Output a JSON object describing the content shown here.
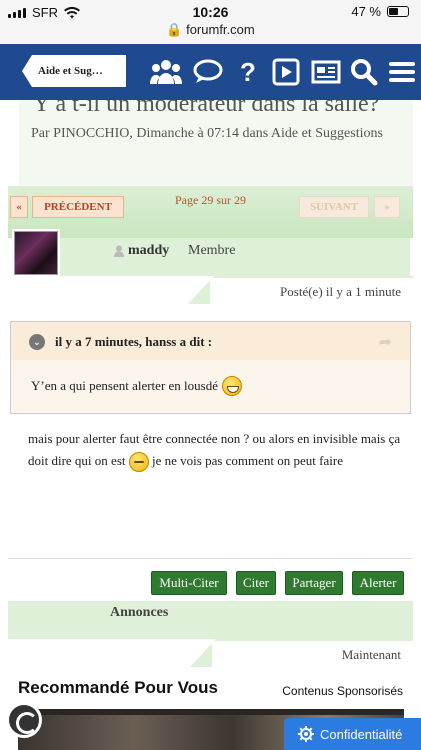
{
  "status_bar": {
    "carrier": "SFR",
    "time": "10:26",
    "battery": "47 %",
    "url": "forumfr.com"
  },
  "header": {
    "back_label": "Aide et Sug…",
    "icons": [
      "users-icon",
      "chat-icon",
      "help-icon",
      "video-icon",
      "news-icon",
      "search-icon",
      "menu-icon"
    ]
  },
  "topic": {
    "title": "Y a t-il un modérateur dans la salle?",
    "byline_prefix": "Par",
    "author": "PINOCCHIO,",
    "date_text": "Dimanche à 07:14 dans Aide et Suggestions"
  },
  "pagination": {
    "first": "«",
    "prev": "PRÉCÉDENT",
    "info": "Page 29 sur 29",
    "next": "SUIVANT",
    "last": "»"
  },
  "post": {
    "username": "maddy",
    "role": "Membre",
    "posted": "Posté(e) il y a 1 minute",
    "quote_header": "il y a 7 minutes, hanss a dit :",
    "quote_text": "Y’en a qui pensent alerter en lousdé",
    "body_part1": "mais pour alerter faut être connectée non ? ou alors en invisible mais ça doit dire qui on est",
    "body_part2": "je ne vois pas comment on peut faire"
  },
  "actions": {
    "multi_quote": "Multi-Citer",
    "quote": "Citer",
    "share": "Partager",
    "report": "Alerter"
  },
  "announcements": {
    "title": "Annonces",
    "time": "Maintenant"
  },
  "recommend": {
    "title": "Recommandé Pour Vous",
    "sponsored": "Contenus Sponsorisés"
  },
  "privacy": {
    "label": "Confidentialité"
  }
}
